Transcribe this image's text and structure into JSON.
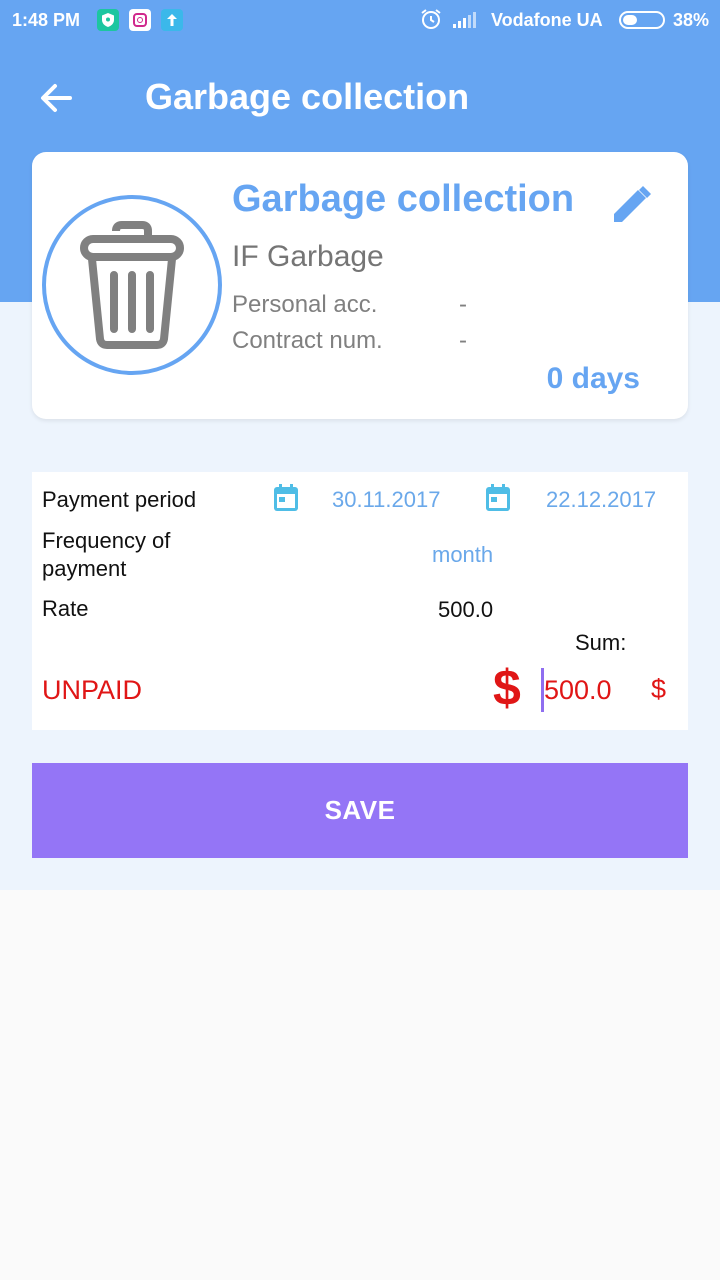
{
  "status_bar": {
    "time": "1:48 PM",
    "carrier": "Vodafone UA",
    "battery": "38%",
    "battery_level": 0.38,
    "icons": [
      "shield-icon",
      "instagram-icon",
      "upload-icon",
      "alarm-icon",
      "signal-icon",
      "battery-icon"
    ]
  },
  "app_bar": {
    "title": "Garbage collection",
    "back_icon": "arrow-left-icon"
  },
  "service_card": {
    "title": "Garbage collection",
    "provider": "IF Garbage",
    "personal_acc_label": "Personal acc.",
    "personal_acc_value": "-",
    "contract_label": "Contract num.",
    "contract_value": "-",
    "days": "0 days",
    "icon": "trash-icon",
    "edit_icon": "pencil-icon"
  },
  "payment": {
    "period_label": "Payment period",
    "date_from": "30.11.2017",
    "date_to": "22.12.2017",
    "frequency_label": "Frequency of payment",
    "frequency_value": "month",
    "rate_label": "Rate",
    "rate_value": "500.0",
    "sum_label": "Sum:",
    "status": "UNPAID",
    "currency_symbol": "$",
    "sum_value": "500.0",
    "sum_currency": "$"
  },
  "actions": {
    "save_label": "SAVE"
  },
  "colors": {
    "primary": "#66a5f2",
    "accent": "#9475f6",
    "unpaid": "#e01616"
  }
}
